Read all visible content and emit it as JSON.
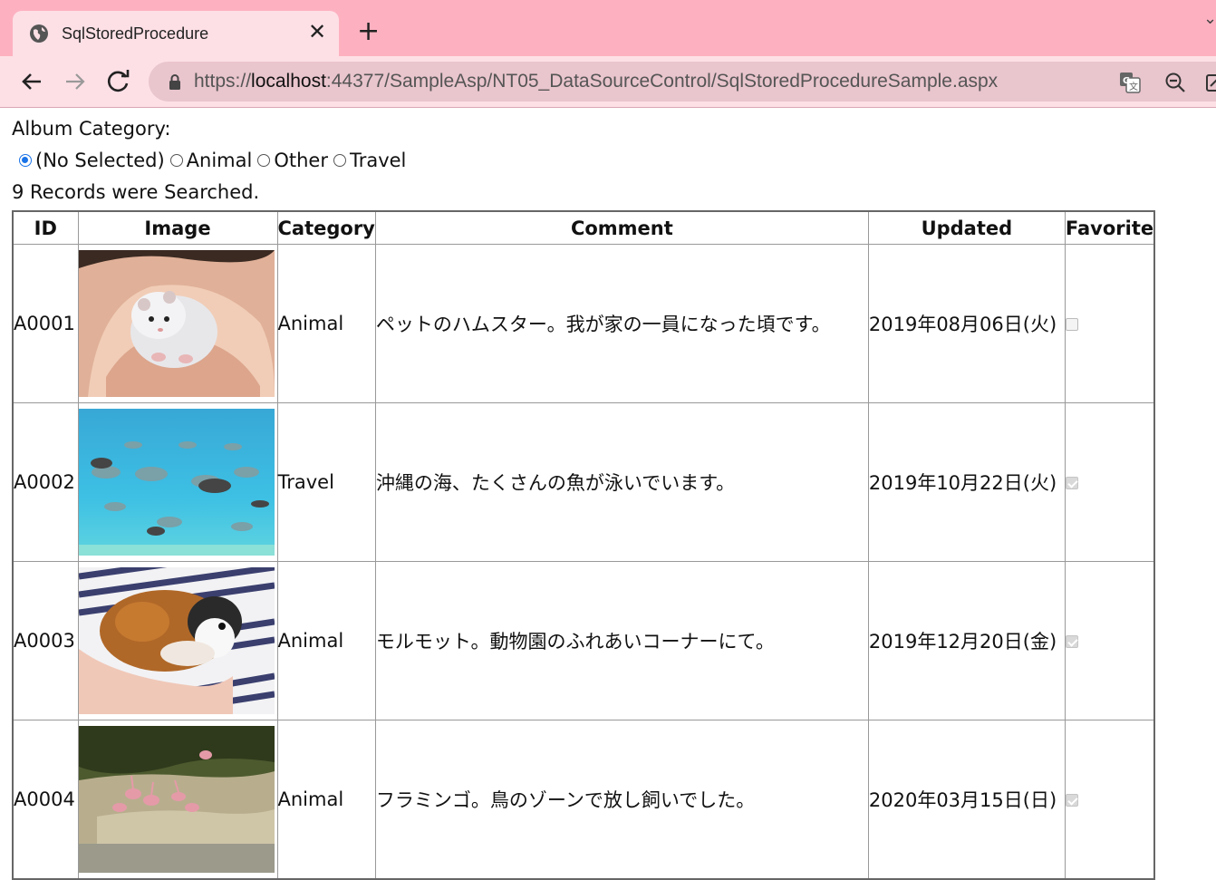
{
  "browser": {
    "tab_title": "SqlStoredProcedure",
    "close_label": "✕",
    "new_tab_label": "+",
    "url_prefix": "https://",
    "url_host": "localhost",
    "url_rest": ":44377/SampleAsp/NT05_DataSourceControl/SqlStoredProcedureSample.aspx"
  },
  "page": {
    "category_label": "Album Category:",
    "radios": [
      {
        "label": "(No Selected)",
        "checked": true
      },
      {
        "label": "Animal",
        "checked": false
      },
      {
        "label": "Other",
        "checked": false
      },
      {
        "label": "Travel",
        "checked": false
      }
    ],
    "record_count": "9 Records were Searched.",
    "columns": [
      "ID",
      "Image",
      "Category",
      "Comment",
      "Updated",
      "Favorite"
    ],
    "rows": [
      {
        "id": "A0001",
        "image": "hamster-photo",
        "category": "Animal",
        "comment": "ペットのハムスター。我が家の一員になった頃です。",
        "updated": "2019年08月06日(火)",
        "favorite": false
      },
      {
        "id": "A0002",
        "image": "fish-photo",
        "category": "Travel",
        "comment": "沖縄の海、たくさんの魚が泳いでいます。",
        "updated": "2019年10月22日(火)",
        "favorite": true
      },
      {
        "id": "A0003",
        "image": "guinea-pig-photo",
        "category": "Animal",
        "comment": "モルモット。動物園のふれあいコーナーにて。",
        "updated": "2019年12月20日(金)",
        "favorite": true
      },
      {
        "id": "A0004",
        "image": "flamingo-photo",
        "category": "Animal",
        "comment": "フラミンゴ。鳥のゾーンで放し飼いでした。",
        "updated": "2020年03月15日(日)",
        "favorite": true
      }
    ]
  }
}
